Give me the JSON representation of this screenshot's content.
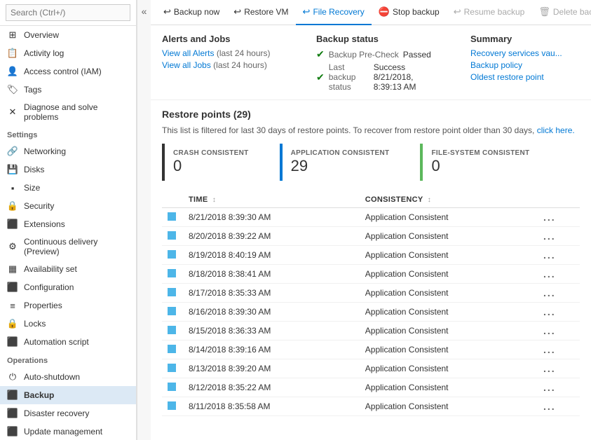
{
  "sidebar": {
    "search_placeholder": "Search (Ctrl+/)",
    "collapse_icon": "«",
    "sections": [
      {
        "items": [
          {
            "id": "overview",
            "label": "Overview",
            "icon": "⊞"
          },
          {
            "id": "activity-log",
            "label": "Activity log",
            "icon": "≡"
          },
          {
            "id": "access-control",
            "label": "Access control (IAM)",
            "icon": "👤"
          },
          {
            "id": "tags",
            "label": "Tags",
            "icon": "🏷"
          },
          {
            "id": "diagnose",
            "label": "Diagnose and solve problems",
            "icon": "✕"
          }
        ]
      },
      {
        "title": "Settings",
        "items": [
          {
            "id": "networking",
            "label": "Networking",
            "icon": "🔗"
          },
          {
            "id": "disks",
            "label": "Disks",
            "icon": "💾"
          },
          {
            "id": "size",
            "label": "Size",
            "icon": "⬛"
          },
          {
            "id": "security",
            "label": "Security",
            "icon": "🔒"
          },
          {
            "id": "extensions",
            "label": "Extensions",
            "icon": "⬛"
          },
          {
            "id": "continuous-delivery",
            "label": "Continuous delivery (Preview)",
            "icon": "⚙"
          },
          {
            "id": "availability-set",
            "label": "Availability set",
            "icon": "⬛"
          },
          {
            "id": "configuration",
            "label": "Configuration",
            "icon": "⬛"
          },
          {
            "id": "properties",
            "label": "Properties",
            "icon": "≡"
          },
          {
            "id": "locks",
            "label": "Locks",
            "icon": "🔒"
          },
          {
            "id": "automation-script",
            "label": "Automation script",
            "icon": "⬛"
          }
        ]
      },
      {
        "title": "Operations",
        "items": [
          {
            "id": "auto-shutdown",
            "label": "Auto-shutdown",
            "icon": "⏻"
          },
          {
            "id": "backup",
            "label": "Backup",
            "icon": "⬛",
            "active": true
          },
          {
            "id": "disaster-recovery",
            "label": "Disaster recovery",
            "icon": "⬛"
          },
          {
            "id": "update-management",
            "label": "Update management",
            "icon": "⬛"
          }
        ]
      }
    ]
  },
  "toolbar": {
    "buttons": [
      {
        "id": "backup-now",
        "label": "Backup now",
        "icon": "↩",
        "active": false
      },
      {
        "id": "restore-vm",
        "label": "Restore VM",
        "icon": "↩",
        "active": false
      },
      {
        "id": "file-recovery",
        "label": "File Recovery",
        "icon": "↩",
        "active": true
      },
      {
        "id": "stop-backup",
        "label": "Stop backup",
        "icon": "⛔",
        "active": false
      },
      {
        "id": "resume-backup",
        "label": "Resume backup",
        "icon": "↩",
        "disabled": true
      },
      {
        "id": "delete-backup-data",
        "label": "Delete backup data",
        "icon": "🗑",
        "disabled": true
      }
    ]
  },
  "info_panels": {
    "alerts_jobs": {
      "title": "Alerts and Jobs",
      "links": [
        {
          "text": "View all Alerts",
          "suffix": " (last 24 hours)"
        },
        {
          "text": "View all Jobs",
          "suffix": " (last 24 hours)"
        }
      ]
    },
    "backup_status": {
      "title": "Backup status",
      "rows": [
        {
          "label": "Backup Pre-Check",
          "value": "Passed",
          "status": "success"
        },
        {
          "label": "Last backup status",
          "value": "Success 8/21/2018, 8:39:13 AM",
          "status": "success"
        }
      ]
    },
    "summary": {
      "title": "Summary",
      "items": [
        "Recovery services vau...",
        "Backup policy",
        "Oldest restore point"
      ]
    }
  },
  "restore_points": {
    "title": "Restore points (29)",
    "filter_text": "This list is filtered for last 30 days of restore points. To recover from restore point older than 30 days,",
    "filter_link": "click here.",
    "consistency_blocks": [
      {
        "label": "CRASH CONSISTENT",
        "count": "0",
        "type": "crash"
      },
      {
        "label": "APPLICATION CONSISTENT",
        "count": "29",
        "type": "app"
      },
      {
        "label": "FILE-SYSTEM CONSISTENT",
        "count": "0",
        "type": "fs"
      }
    ],
    "table": {
      "columns": [
        {
          "id": "indicator",
          "label": ""
        },
        {
          "id": "time",
          "label": "TIME",
          "sortable": true
        },
        {
          "id": "consistency",
          "label": "CONSISTENCY",
          "sortable": true
        },
        {
          "id": "actions",
          "label": ""
        }
      ],
      "rows": [
        {
          "time": "8/21/2018 8:39:30 AM",
          "consistency": "Application Consistent"
        },
        {
          "time": "8/20/2018 8:39:22 AM",
          "consistency": "Application Consistent"
        },
        {
          "time": "8/19/2018 8:40:19 AM",
          "consistency": "Application Consistent"
        },
        {
          "time": "8/18/2018 8:38:41 AM",
          "consistency": "Application Consistent"
        },
        {
          "time": "8/17/2018 8:35:33 AM",
          "consistency": "Application Consistent"
        },
        {
          "time": "8/16/2018 8:39:30 AM",
          "consistency": "Application Consistent"
        },
        {
          "time": "8/15/2018 8:36:33 AM",
          "consistency": "Application Consistent"
        },
        {
          "time": "8/14/2018 8:39:16 AM",
          "consistency": "Application Consistent"
        },
        {
          "time": "8/13/2018 8:39:20 AM",
          "consistency": "Application Consistent"
        },
        {
          "time": "8/12/2018 8:35:22 AM",
          "consistency": "Application Consistent"
        },
        {
          "time": "8/11/2018 8:35:58 AM",
          "consistency": "Application Consistent"
        }
      ]
    }
  }
}
